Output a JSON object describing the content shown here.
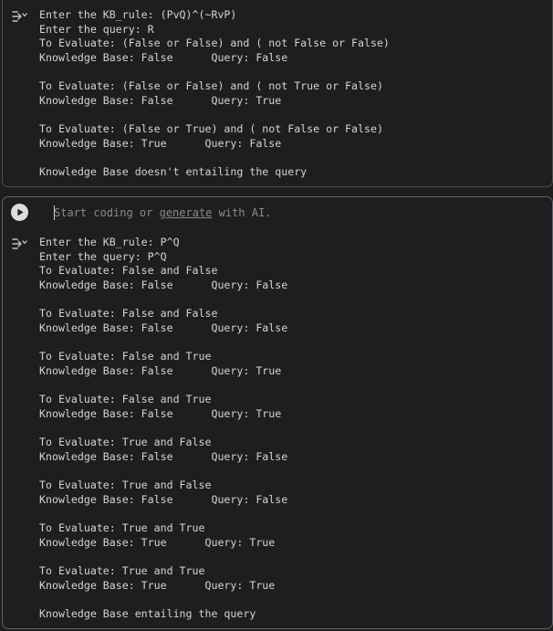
{
  "icons": {
    "output_toggle": "output-toggle-icon",
    "run": "play-icon"
  },
  "colors": {
    "background": "#1e1e1e",
    "text": "#d4d4d4",
    "placeholder": "#8a8a8a",
    "run_button": "#dadce0"
  },
  "cell1": {
    "lines": [
      "Enter the KB_rule: (PvQ)^(~RvP)",
      "Enter the query: R",
      "To Evaluate: (False or False) and ( not False or False)",
      "Knowledge Base: False      Query: False",
      "",
      "To Evaluate: (False or False) and ( not True or False)",
      "Knowledge Base: False      Query: True",
      "",
      "To Evaluate: (False or True) and ( not False or False)",
      "Knowledge Base: True      Query: False",
      "",
      "Knowledge Base doesn't entailing the query"
    ]
  },
  "cell2": {
    "placeholder": {
      "before": "Start coding or ",
      "link": "generate",
      "after": " with AI."
    },
    "lines": [
      "Enter the KB_rule: P^Q",
      "Enter the query: P^Q",
      "To Evaluate: False and False",
      "Knowledge Base: False      Query: False",
      "",
      "To Evaluate: False and False",
      "Knowledge Base: False      Query: False",
      "",
      "To Evaluate: False and True",
      "Knowledge Base: False      Query: True",
      "",
      "To Evaluate: False and True",
      "Knowledge Base: False      Query: True",
      "",
      "To Evaluate: True and False",
      "Knowledge Base: False      Query: False",
      "",
      "To Evaluate: True and False",
      "Knowledge Base: False      Query: False",
      "",
      "To Evaluate: True and True",
      "Knowledge Base: True      Query: True",
      "",
      "To Evaluate: True and True",
      "Knowledge Base: True      Query: True",
      "",
      "Knowledge Base entailing the query"
    ]
  }
}
